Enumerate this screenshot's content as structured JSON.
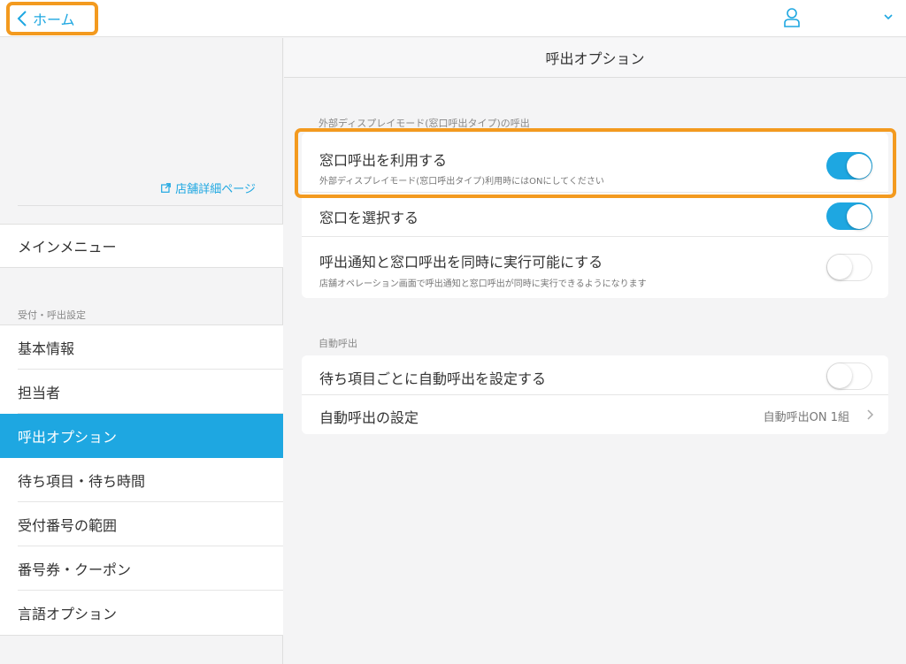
{
  "topbar": {
    "home_label": "ホーム"
  },
  "sidebar": {
    "store_link": "店舗詳細ページ",
    "main_menu": "メインメニュー",
    "section_label": "受付・呼出設定",
    "items": [
      {
        "label": "基本情報"
      },
      {
        "label": "担当者"
      },
      {
        "label": "呼出オプション"
      },
      {
        "label": "待ち項目・待ち時間"
      },
      {
        "label": "受付番号の範囲"
      },
      {
        "label": "番号券・クーポン"
      },
      {
        "label": "言語オプション"
      }
    ]
  },
  "main": {
    "title": "呼出オプション",
    "group1": {
      "label": "外部ディスプレイモード(窓口呼出タイプ)の呼出",
      "rows": [
        {
          "title": "窓口呼出を利用する",
          "desc": "外部ディスプレイモード(窓口呼出タイプ)利用時にはONにしてください",
          "on": true
        },
        {
          "title": "窓口を選択する",
          "on": true
        },
        {
          "title": "呼出通知と窓口呼出を同時に実行可能にする",
          "desc": "店舗オペレーション画面で呼出通知と窓口呼出が同時に実行できるようになります",
          "on": false
        }
      ]
    },
    "group2": {
      "label": "自動呼出",
      "rows": [
        {
          "title": "待ち項目ごとに自動呼出を設定する",
          "on": false
        },
        {
          "title": "自動呼出の設定",
          "value": "自動呼出ON 1組"
        }
      ]
    }
  },
  "colors": {
    "accent": "#1ea7e1",
    "highlight": "#f39a1f"
  }
}
